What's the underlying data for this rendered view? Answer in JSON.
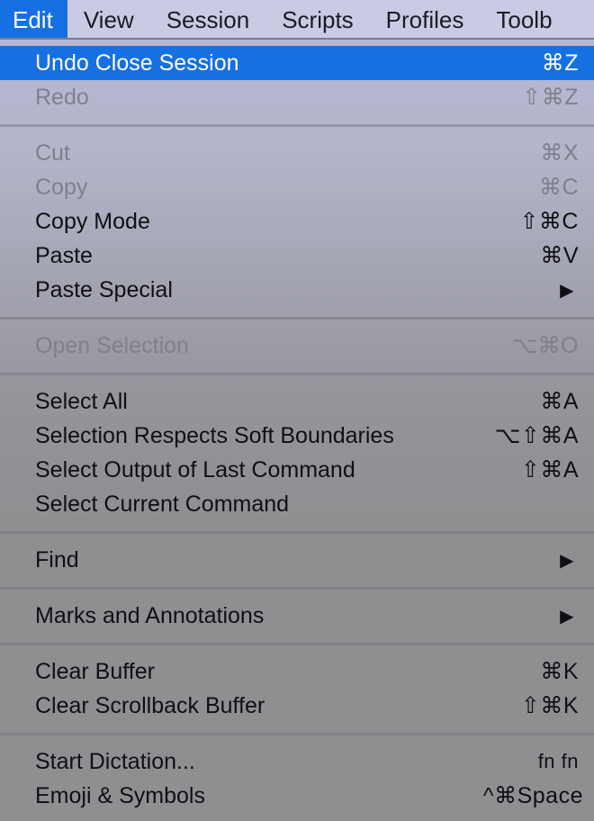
{
  "menubar": {
    "items": [
      "Edit",
      "View",
      "Session",
      "Scripts",
      "Profiles",
      "Toolb"
    ],
    "active": "Edit"
  },
  "menu": {
    "groups": [
      [
        {
          "label": "Undo Close Session",
          "shortcut": "⌘Z",
          "state": "highlighted"
        },
        {
          "label": "Redo",
          "shortcut": "⇧⌘Z",
          "state": "disabled"
        }
      ],
      [
        {
          "label": "Cut",
          "shortcut": "⌘X",
          "state": "disabled"
        },
        {
          "label": "Copy",
          "shortcut": "⌘C",
          "state": "disabled"
        },
        {
          "label": "Copy Mode",
          "shortcut": "⇧⌘C",
          "state": "enabled"
        },
        {
          "label": "Paste",
          "shortcut": "⌘V",
          "state": "enabled"
        },
        {
          "label": "Paste Special",
          "shortcut": "▶",
          "state": "enabled",
          "submenu": true
        }
      ],
      [
        {
          "label": "Open Selection",
          "shortcut": "⌥⌘O",
          "state": "disabled"
        }
      ],
      [
        {
          "label": "Select All",
          "shortcut": "⌘A",
          "state": "enabled"
        },
        {
          "label": "Selection Respects Soft Boundaries",
          "shortcut": "⌥⇧⌘A",
          "state": "enabled"
        },
        {
          "label": "Select Output of Last Command",
          "shortcut": "⇧⌘A",
          "state": "enabled"
        },
        {
          "label": "Select Current Command",
          "shortcut": "",
          "state": "enabled"
        }
      ],
      [
        {
          "label": "Find",
          "shortcut": "▶",
          "state": "enabled",
          "submenu": true
        }
      ],
      [
        {
          "label": "Marks and Annotations",
          "shortcut": "▶",
          "state": "enabled",
          "submenu": true
        }
      ],
      [
        {
          "label": "Clear Buffer",
          "shortcut": "⌘K",
          "state": "enabled"
        },
        {
          "label": "Clear Scrollback Buffer",
          "shortcut": "⇧⌘K",
          "state": "enabled"
        }
      ],
      [
        {
          "label": "Start Dictation...",
          "shortcut": "fn fn",
          "state": "enabled"
        },
        {
          "label": "Emoji & Symbols",
          "shortcut": "^⌘Space",
          "state": "enabled"
        }
      ]
    ]
  }
}
